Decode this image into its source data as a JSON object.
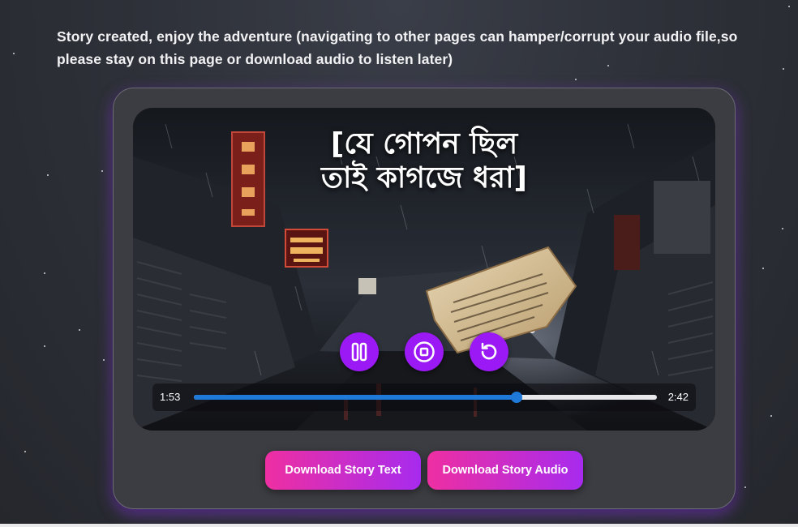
{
  "notice": "Story created, enjoy the adventure (navigating to other pages can hamper/corrupt your audio file,so please stay on this page or download audio to listen later)",
  "player": {
    "title_line1": "[যে গোপন ছিল",
    "title_line2": "তাই কাগজে ধরা]",
    "current_time": "1:53",
    "total_time": "2:42",
    "progress": 0.697,
    "icons": {
      "pause": "pause-icon",
      "stop": "stop-icon",
      "restart": "restart-icon"
    }
  },
  "buttons": {
    "download_text": "Download Story Text",
    "download_audio": "Download Story Audio"
  },
  "colors": {
    "control_bg": "#9b19f5",
    "progress_fill": "#1f79d8",
    "button_gradient_start": "#ee2fa2",
    "button_gradient_end": "#a72bee"
  }
}
